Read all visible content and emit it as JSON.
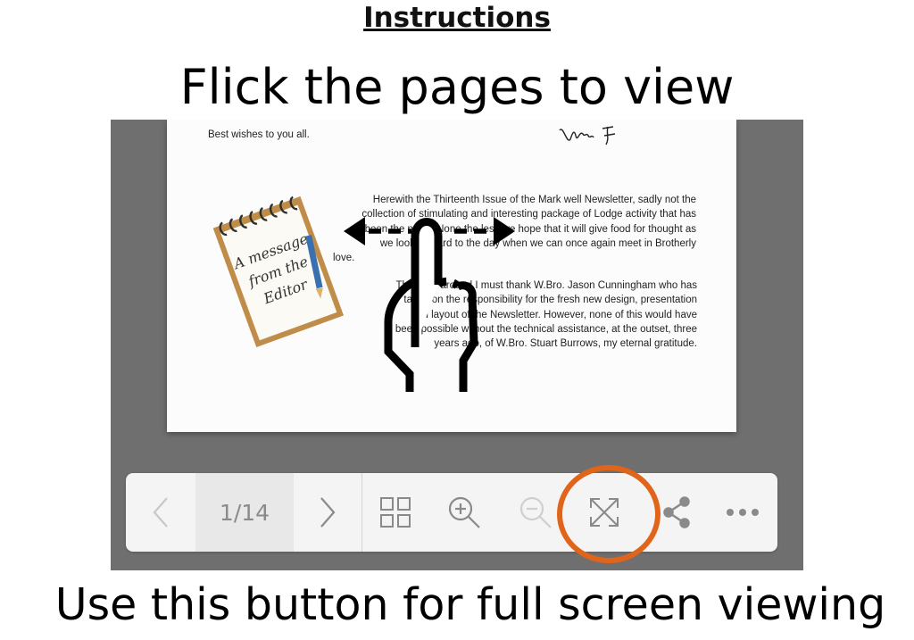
{
  "instructions": {
    "heading": "Instructions",
    "subheading": "Flick the pages to view",
    "caption": "Use this button for full screen viewing"
  },
  "page": {
    "greeting": "Best wishes to you all.",
    "notepad_text": [
      "A message",
      "from the",
      "Editor"
    ],
    "paragraph1_lines": [
      "Herewith the Thirteenth Issue of the Mark well Newsletter, sadly not the",
      "collection of stimulating and interesting package of Lodge activity that has",
      "been the norm. None the less we hope that it will give food for thought as",
      "we look forward to the day when we can once again meet in Brotherly",
      "love."
    ],
    "paragraph2_lines": [
      "This time around I must thank W.Bro. Jason Cunningham who has",
      "taken on the responsibility for the fresh new design, presentation",
      "and layout of the Newsletter. However, none of this would have",
      "been possible without the technical assistance, at the outset, three",
      "years ago, of W.Bro. Stuart Burrows, my eternal gratitude."
    ]
  },
  "toolbar": {
    "page_indicator": "1/14",
    "buttons": [
      "previous-page",
      "next-page",
      "thumbnails",
      "zoom-in",
      "zoom-out",
      "fullscreen",
      "share",
      "more"
    ]
  },
  "colors": {
    "viewer_background": "#6f6f6f",
    "toolbar_background": "#f4f4f4",
    "highlight_ring": "#e06419",
    "icon_gray": "#8a8a8a"
  }
}
